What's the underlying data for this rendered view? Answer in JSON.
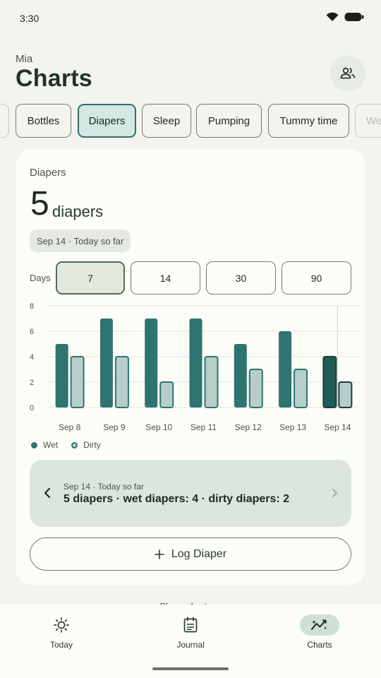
{
  "status": {
    "time": "3:30"
  },
  "header": {
    "child_name": "Mia",
    "title": "Charts"
  },
  "tabs": [
    {
      "label": "",
      "selected": false
    },
    {
      "label": "Bottles",
      "selected": false
    },
    {
      "label": "Diapers",
      "selected": true
    },
    {
      "label": "Sleep",
      "selected": false
    },
    {
      "label": "Pumping",
      "selected": false
    },
    {
      "label": "Tummy time",
      "selected": false
    },
    {
      "label": "We",
      "selected": false
    }
  ],
  "card": {
    "label": "Diapers",
    "big_number": "5",
    "big_unit": "diapers",
    "date_pill": "Sep 14 · Today so far",
    "days_label": "Days",
    "ranges": [
      {
        "label": "7",
        "selected": true
      },
      {
        "label": "14",
        "selected": false
      },
      {
        "label": "30",
        "selected": false
      },
      {
        "label": "90",
        "selected": false
      }
    ]
  },
  "chart_data": {
    "type": "bar",
    "categories": [
      "Sep 8",
      "Sep 9",
      "Sep 10",
      "Sep 11",
      "Sep 12",
      "Sep 13",
      "Sep 14"
    ],
    "series": [
      {
        "name": "Wet",
        "values": [
          5,
          7,
          7,
          7,
          5,
          6,
          4
        ],
        "color": "#2e7470"
      },
      {
        "name": "Dirty",
        "values": [
          4,
          4,
          2,
          4,
          3,
          3,
          2
        ],
        "color": "#b7cec8"
      }
    ],
    "yticks": [
      0,
      2,
      4,
      6,
      8
    ],
    "ylim": [
      0,
      8
    ],
    "highlight_category": "Sep 14",
    "grid": true,
    "legend": "bottom-left"
  },
  "detail": {
    "date": "Sep 14 · Today so far",
    "summary": "5 diapers · wet diapers: 4 · dirty diapers: 2"
  },
  "log_button": {
    "label": "Log Diaper"
  },
  "peek_text": "Share chart",
  "nav": [
    {
      "label": "Today",
      "icon": "sun-icon",
      "active": false
    },
    {
      "label": "Journal",
      "icon": "journal-icon",
      "active": false
    },
    {
      "label": "Charts",
      "icon": "charts-icon",
      "active": true
    }
  ]
}
